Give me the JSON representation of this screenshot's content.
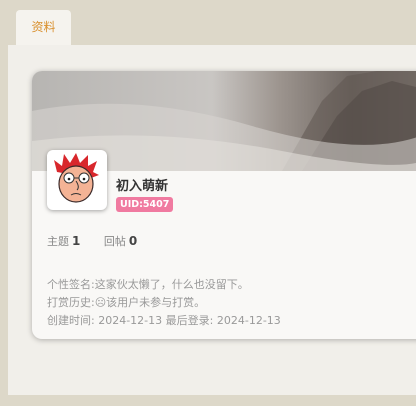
{
  "tabs": [
    {
      "label": "资料"
    }
  ],
  "profile": {
    "username": "初入萌新",
    "uid_badge": "UID:5407",
    "stats": [
      {
        "label": "主题",
        "value": "1"
      },
      {
        "label": "回帖",
        "value": "0"
      }
    ],
    "signature": {
      "label": "个性签名:",
      "value": "这家伙太懒了，什么也没留下。"
    },
    "tip_history": {
      "label": "打赏历史:",
      "value": "☹该用户未参与打赏。"
    },
    "created": {
      "label": "创建时间:",
      "value": "2024-12-13"
    },
    "last_login": {
      "label": "最后登录:",
      "value": "2024-12-13"
    }
  },
  "colors": {
    "tab_text": "#d9902e",
    "uid_badge": "#f07aa0",
    "background": "#ddd8c9"
  }
}
